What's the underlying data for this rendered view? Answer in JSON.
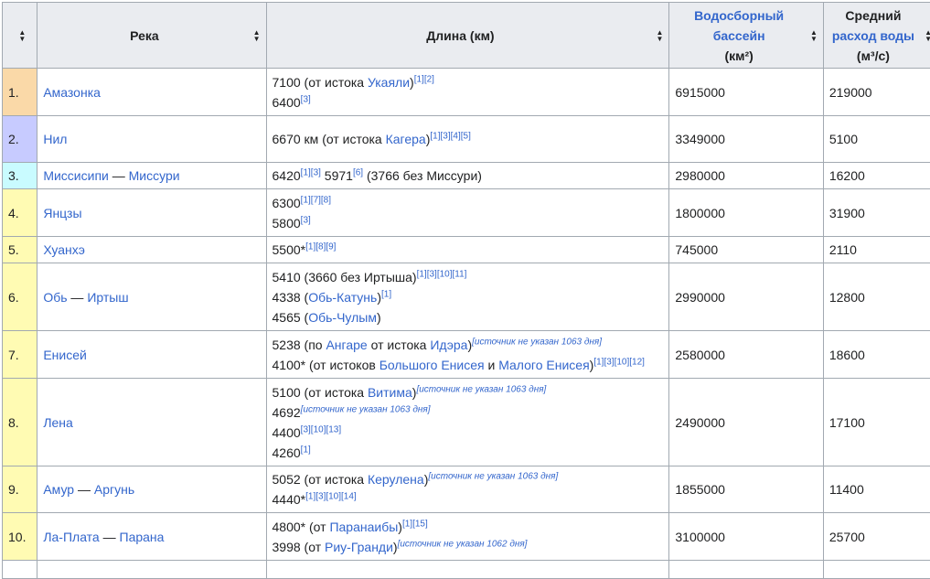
{
  "headers": {
    "rank": "",
    "river": "Река",
    "length": "Длина (км)",
    "basin_link": "Водосборный бассейн",
    "basin_unit": "(км²)",
    "flow_prefix": "Средний",
    "flow_link": "расход воды",
    "flow_unit": "(м³/с)"
  },
  "colors": {
    "r1": "#fad9a8",
    "r2": "#c7cbff",
    "r3": "#c9fbff",
    "r4": "#fffbb3",
    "r5": "#fffbb3",
    "r6": "#fffbb3",
    "r7": "#fffbb3",
    "r8": "#fffbb3",
    "r9": "#fffbb3",
    "r10": "#fffbb3"
  },
  "rows": [
    {
      "rank": "1.",
      "river": "Амазонка",
      "basin": "6915000",
      "flow": "219000"
    },
    {
      "rank": "2.",
      "river": "Нил",
      "basin": "3349000",
      "flow": "5100"
    },
    {
      "rank": "3.",
      "river_a": "Миссисипи",
      "sep": " — ",
      "river_b": "Миссури",
      "basin": "2980000",
      "flow": "16200"
    },
    {
      "rank": "4.",
      "river": "Янцзы",
      "basin": "1800000",
      "flow": "31900"
    },
    {
      "rank": "5.",
      "river": "Хуанхэ",
      "basin": "745000",
      "flow": "2110"
    },
    {
      "rank": "6.",
      "river_a": "Обь",
      "sep": " — ",
      "river_b": "Иртыш",
      "basin": "2990000",
      "flow": "12800"
    },
    {
      "rank": "7.",
      "river": "Енисей",
      "basin": "2580000",
      "flow": "18600"
    },
    {
      "rank": "8.",
      "river": "Лена",
      "basin": "2490000",
      "flow": "17100"
    },
    {
      "rank": "9.",
      "river_a": "Амур",
      "sep": " — ",
      "river_b": "Аргунь",
      "basin": "1855000",
      "flow": "11400"
    },
    {
      "rank": "10.",
      "river_a": "Ла-Плата",
      "sep": " — ",
      "river_b": "Парана",
      "basin": "3100000",
      "flow": "25700"
    }
  ],
  "len": {
    "r1": {
      "a": "7100 (от истока ",
      "a_link": "Укаяли",
      "a_end": ")",
      "a_sup": "[1][2]",
      "b": "6400",
      "b_sup": "[3]"
    },
    "r2": {
      "a": "6670 км (от истока ",
      "a_link": "Кагера",
      "a_end": ")",
      "a_sup": "[1][3][4][5]"
    },
    "r3": {
      "a": "6420",
      "a_sup": "[1][3]",
      "b": " 5971",
      "b_sup": "[6]",
      "c": " (3766 без Миссури)"
    },
    "r4": {
      "a": "6300",
      "a_sup": "[1][7][8]",
      "b": "5800",
      "b_sup": "[3]"
    },
    "r5": {
      "a": "5500*",
      "a_sup": "[1][8][9]"
    },
    "r6": {
      "a": "5410 (3660 без Иртыша)",
      "a_sup": "[1][3][10][11]",
      "b": "4338 (",
      "b_link": "Обь-Катунь",
      "b_end": ")",
      "b_sup": "[1]",
      "c": "4565 (",
      "c_link": "Обь-Чулым",
      "c_end": ")"
    },
    "r7": {
      "a": "5238 (по ",
      "a_link1": "Ангаре",
      "a_mid": " от истока ",
      "a_link2": "Идэра",
      "a_end": ")",
      "a_sup": "[источник не указан 1063 дня]",
      "b": "4100* (от истоков ",
      "b_link1": "Большого Енисея",
      "b_mid": " и ",
      "b_link2": "Малого Енисея",
      "b_end": ")",
      "b_sup": "[1][3][10][12]"
    },
    "r8": {
      "a": "5100 (от истока ",
      "a_link": "Витима",
      "a_end": ")",
      "a_sup": "[источник не указан 1063 дня]",
      "b": "4692",
      "b_sup": "[источник не указан 1063 дня]",
      "c": "4400",
      "c_sup": "[3][10][13]",
      "d": "4260",
      "d_sup": "[1]"
    },
    "r9": {
      "a": "5052 (от истока ",
      "a_link": "Керулена",
      "a_end": ")",
      "a_sup": "[источник не указан 1063 дня]",
      "b": "4440*",
      "b_sup": "[1][3][10][14]"
    },
    "r10": {
      "a": "4800* (от ",
      "a_link": "Паранаибы",
      "a_end": ")",
      "a_sup": "[1][15]",
      "b": "3998 (от ",
      "b_link": "Риу-Гранди",
      "b_end": ")",
      "b_sup": "[источник не указан 1062 дня]"
    }
  }
}
